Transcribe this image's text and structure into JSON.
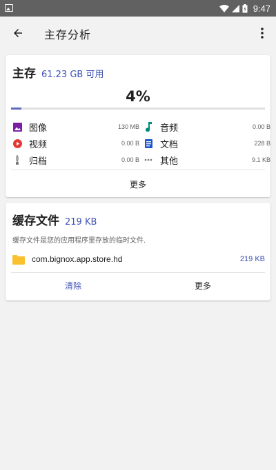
{
  "status_bar": {
    "time": "9:47",
    "icons": [
      "image-icon",
      "wifi-icon",
      "signal-icon",
      "battery-icon"
    ]
  },
  "app_bar": {
    "title": "主存分析",
    "back_icon": "arrow-back-icon",
    "menu_icon": "more-vert-icon"
  },
  "storage": {
    "heading": "主存",
    "available": "61.23 GB 可用",
    "percent_text": "4%",
    "used_fraction": 0.04,
    "categories": [
      {
        "label": "图像",
        "size": "130 MB",
        "icon": "image-icon",
        "color": "#7b1fa2"
      },
      {
        "label": "音频",
        "size": "0.00 B",
        "icon": "music-note-icon",
        "color": "#00897b"
      },
      {
        "label": "视频",
        "size": "0.00 B",
        "icon": "play-circle-icon",
        "color": "#e53935"
      },
      {
        "label": "文档",
        "size": "228 B",
        "icon": "document-icon",
        "color": "#1e56c8"
      },
      {
        "label": "归档",
        "size": "0.00 B",
        "icon": "archive-icon",
        "color": "#757575"
      },
      {
        "label": "其他",
        "size": "9.1 KB",
        "icon": "more-horiz-icon",
        "color": "#757575"
      }
    ],
    "more_label": "更多"
  },
  "cache": {
    "heading": "缓存文件",
    "size": "219 KB",
    "description": "缓存文件是您的应用程序里存放的临时文件.",
    "entry": {
      "name": "com.bignox.app.store.hd",
      "size": "219 KB",
      "icon": "folder-icon",
      "icon_color": "#fbc02d"
    },
    "clear_label": "清除",
    "more_label": "更多"
  },
  "colors": {
    "accent": "#3f51b5",
    "status_bar": "#616161",
    "background": "#f2f2f2"
  }
}
